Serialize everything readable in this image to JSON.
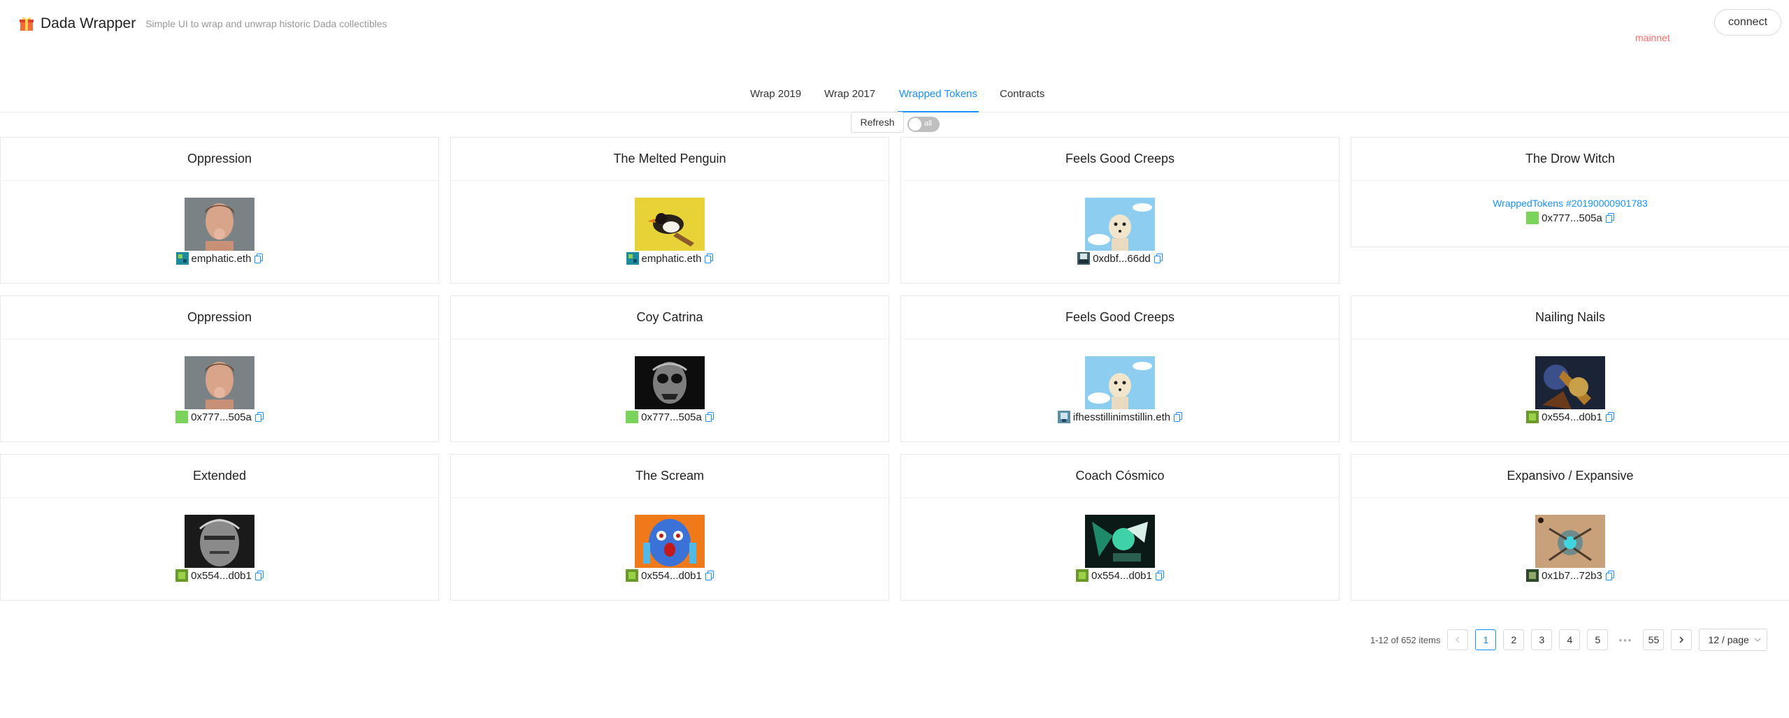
{
  "header": {
    "title": "Dada Wrapper",
    "subtitle": "Simple UI to wrap and unwrap historic Dada collectibles",
    "network": "mainnet",
    "connect_label": "connect",
    "icon": "gift-icon",
    "network_color": "#ff6b6b"
  },
  "tabs": [
    "Wrap 2019",
    "Wrap 2017",
    "Wrapped Tokens",
    "Contracts"
  ],
  "active_tab": "Wrapped Tokens",
  "toolbar": {
    "refresh_label": "Refresh",
    "toggle_label": "all"
  },
  "cards": [
    {
      "title": "Oppression",
      "owner": "emphatic.eth",
      "image": "portrait-woman"
    },
    {
      "title": "The Melted Penguin",
      "owner": "emphatic.eth",
      "image": "penguin"
    },
    {
      "title": "Feels Good Creeps",
      "owner": "0xdbf...66dd",
      "image": "chihuahua"
    },
    {
      "title": "The Drow Witch",
      "owner": "0x777...505a",
      "image": "broken",
      "alt": "WrappedTokens #20190000901783"
    },
    {
      "title": "Oppression",
      "owner": "0x777...505a",
      "image": "portrait-woman"
    },
    {
      "title": "Coy Catrina",
      "owner": "0x777...505a",
      "image": "catrina"
    },
    {
      "title": "Feels Good Creeps",
      "owner": "ifhesstillinimstillin.eth",
      "image": "chihuahua"
    },
    {
      "title": "Nailing Nails",
      "owner": "0x554...d0b1",
      "image": "nails"
    },
    {
      "title": "Extended",
      "owner": "0x554...d0b1",
      "image": "mask"
    },
    {
      "title": "The Scream",
      "owner": "0x554...d0b1",
      "image": "scream"
    },
    {
      "title": "Coach Cósmico",
      "owner": "0x554...d0b1",
      "image": "cosmico"
    },
    {
      "title": "Expansivo / Expansive",
      "owner": "0x1b7...72b3",
      "image": "expansivo"
    }
  ],
  "pagination": {
    "summary": "1-12 of 652 items",
    "pages": [
      "1",
      "2",
      "3",
      "4",
      "5"
    ],
    "ellipsis": "•••",
    "last_page": "55",
    "current": "1",
    "page_size": "12 / page"
  },
  "colors": {
    "accent": "#1890ff"
  }
}
